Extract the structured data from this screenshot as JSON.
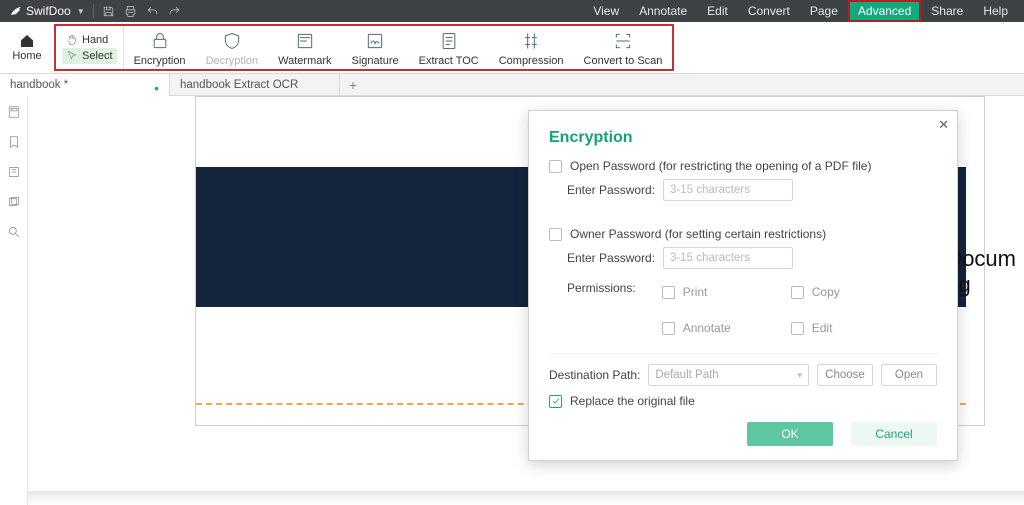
{
  "app": {
    "name": "SwifDoo"
  },
  "menubar": {
    "items": [
      "View",
      "Annotate",
      "Edit",
      "Convert",
      "Page",
      "Advanced",
      "Share",
      "Help"
    ],
    "active": "Advanced"
  },
  "home": {
    "label": "Home"
  },
  "cursor_tools": {
    "hand": "Hand",
    "select": "Select"
  },
  "ribbon": [
    {
      "label": "Encryption",
      "icon": "lock",
      "disabled": false
    },
    {
      "label": "Decryption",
      "icon": "shield",
      "disabled": true
    },
    {
      "label": "Watermark",
      "icon": "watermark",
      "disabled": false
    },
    {
      "label": "Signature",
      "icon": "sign",
      "disabled": false
    },
    {
      "label": "Extract TOC",
      "icon": "toc",
      "disabled": false
    },
    {
      "label": "Compression",
      "icon": "compress",
      "disabled": false
    },
    {
      "label": "Convert to Scan",
      "icon": "scan",
      "disabled": false
    }
  ],
  "tabs": [
    {
      "label": "handbook *",
      "modified": true
    },
    {
      "label": "handbook Extract OCR",
      "modified": false
    }
  ],
  "doc_preview": {
    "title_fragment": "Docum\nng"
  },
  "dialog": {
    "title": "Encryption",
    "open_pw_label": "Open Password (for restricting the opening of a PDF file)",
    "enter_pw_label": "Enter Password:",
    "pw_placeholder": "3-15 characters",
    "owner_pw_label": "Owner Password (for setting certain restrictions)",
    "permissions_label": "Permissions:",
    "perm": {
      "print": "Print",
      "copy": "Copy",
      "annotate": "Annotate",
      "edit": "Edit"
    },
    "dest_label": "Destination Path:",
    "dest_value": "Default Path",
    "choose": "Choose",
    "open": "Open",
    "replace_label": "Replace the original file",
    "ok": "OK",
    "cancel": "Cancel"
  }
}
